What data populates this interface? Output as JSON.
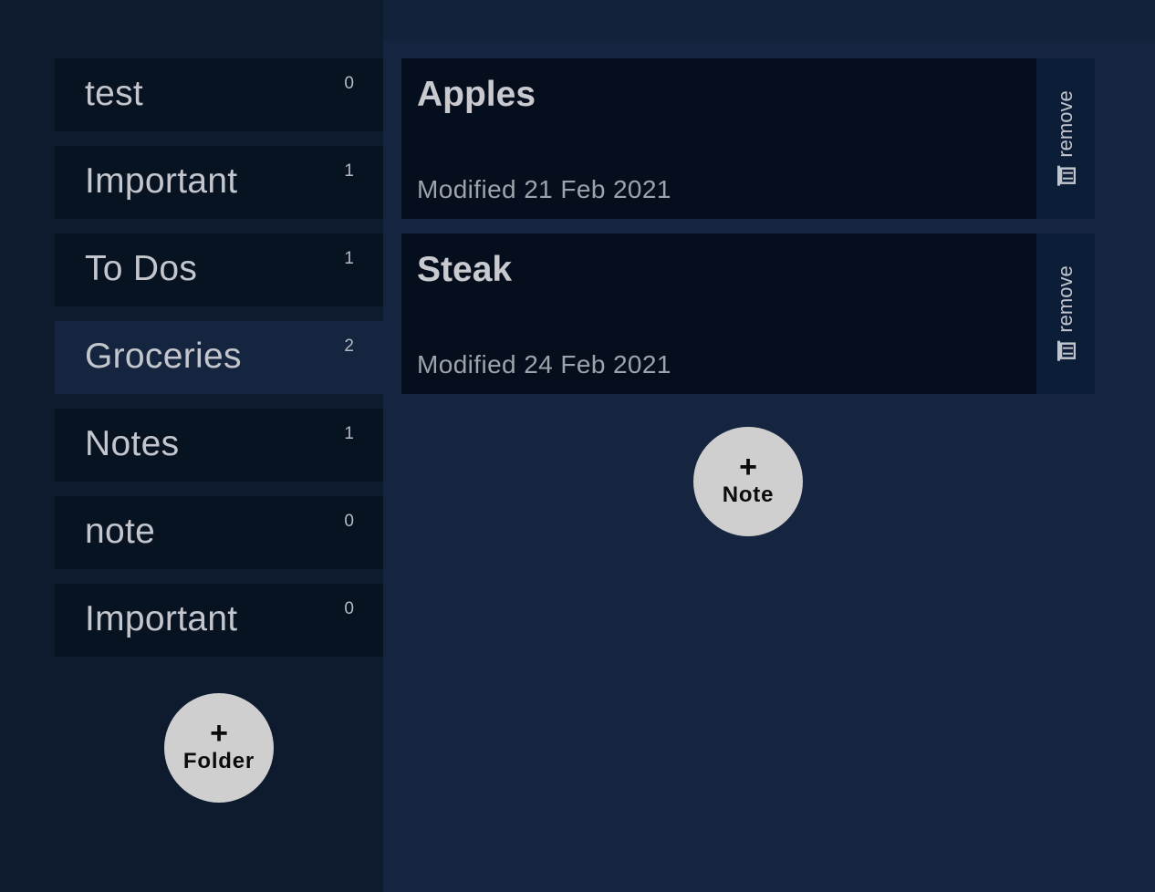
{
  "folders": [
    {
      "name": "test",
      "count": "0"
    },
    {
      "name": "Important",
      "count": "1"
    },
    {
      "name": "To Dos",
      "count": "1"
    },
    {
      "name": "Groceries",
      "count": "2",
      "selected": true
    },
    {
      "name": "Notes",
      "count": "1"
    },
    {
      "name": "note",
      "count": "0"
    },
    {
      "name": "Important",
      "count": "0"
    }
  ],
  "add_folder": {
    "icon": "plus-icon",
    "plus": "+",
    "label": "Folder"
  },
  "notes": [
    {
      "title": "Apples",
      "modified": "Modified 21 Feb 2021",
      "remove_label": "remove",
      "remove_icon": "trash-icon"
    },
    {
      "title": "Steak",
      "modified": "Modified 24 Feb 2021",
      "remove_label": "remove",
      "remove_icon": "trash-icon"
    }
  ],
  "add_note": {
    "icon": "plus-icon",
    "plus": "+",
    "label": "Note"
  },
  "colors": {
    "folders_background": "#0e1b2e",
    "notes_background": "#16253f",
    "item_background": "#081322",
    "selected_item": "#16253f",
    "fab": "#cfcfcf"
  }
}
